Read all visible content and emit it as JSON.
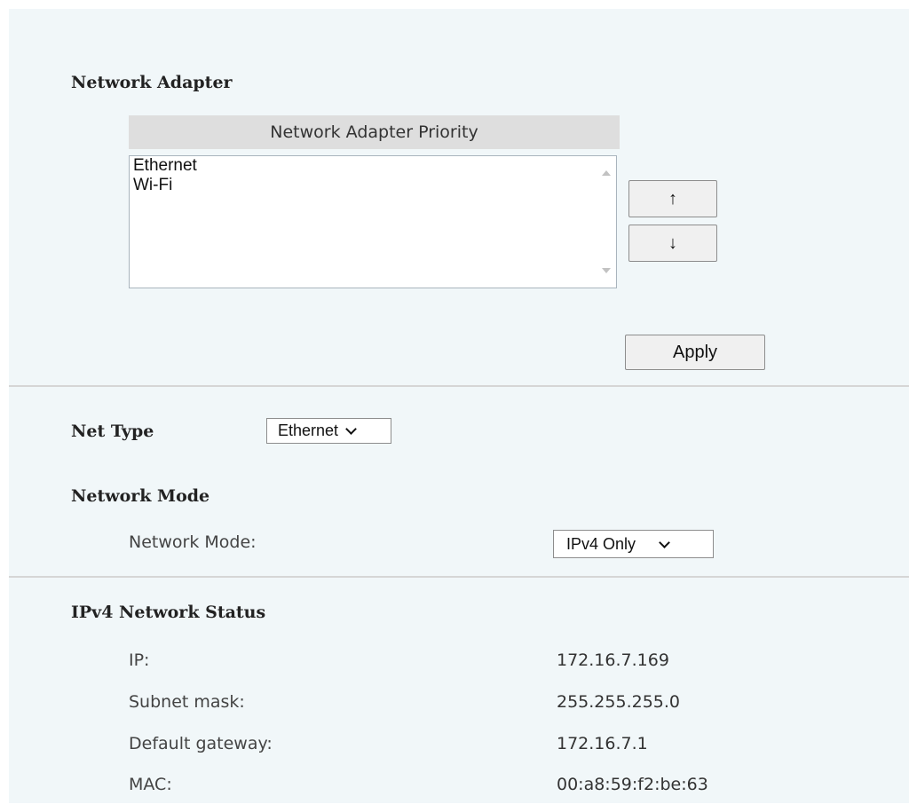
{
  "network_adapter": {
    "heading": "Network Adapter",
    "priority_header": "Network Adapter Priority",
    "adapters": [
      "Ethernet",
      "Wi-Fi"
    ],
    "up_label": "↑",
    "down_label": "↓",
    "apply_label": "Apply"
  },
  "net_type": {
    "label": "Net Type",
    "selected": "Ethernet"
  },
  "network_mode": {
    "heading": "Network Mode",
    "label": "Network Mode:",
    "selected": "IPv4 Only"
  },
  "ipv4_status": {
    "heading": "IPv4 Network Status",
    "rows": [
      {
        "label": "IP:",
        "value": "172.16.7.169"
      },
      {
        "label": "Subnet mask:",
        "value": "255.255.255.0"
      },
      {
        "label": "Default gateway:",
        "value": "172.16.7.1"
      },
      {
        "label": "MAC:",
        "value": "00:a8:59:f2:be:63"
      }
    ]
  }
}
